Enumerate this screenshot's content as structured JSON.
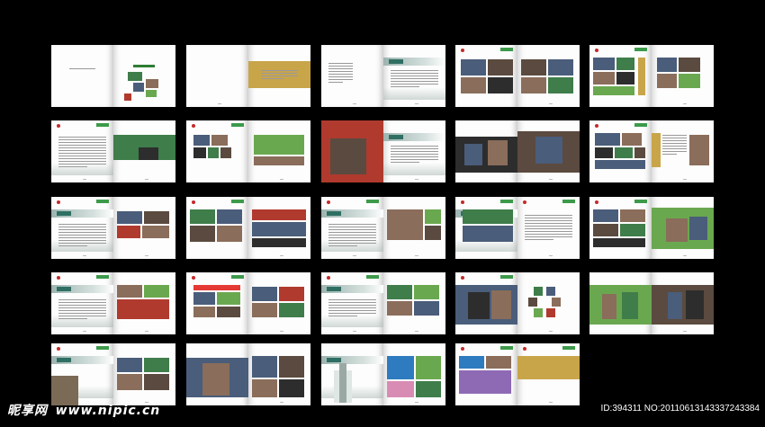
{
  "footer": {
    "site_logo": "昵享网",
    "site_url": "www.nipic.cn",
    "image_id": "ID:394311 NO:20110613143337243384"
  },
  "colors": {
    "background": "#000000",
    "page": "#fdfdfd",
    "accent_gold": "#c9a54a",
    "accent_teal": "#2f6f63",
    "brand_green": "#3d9a4a",
    "brand_red": "#c62828"
  },
  "layout_name": "brochure-spreads-grid-5x5"
}
